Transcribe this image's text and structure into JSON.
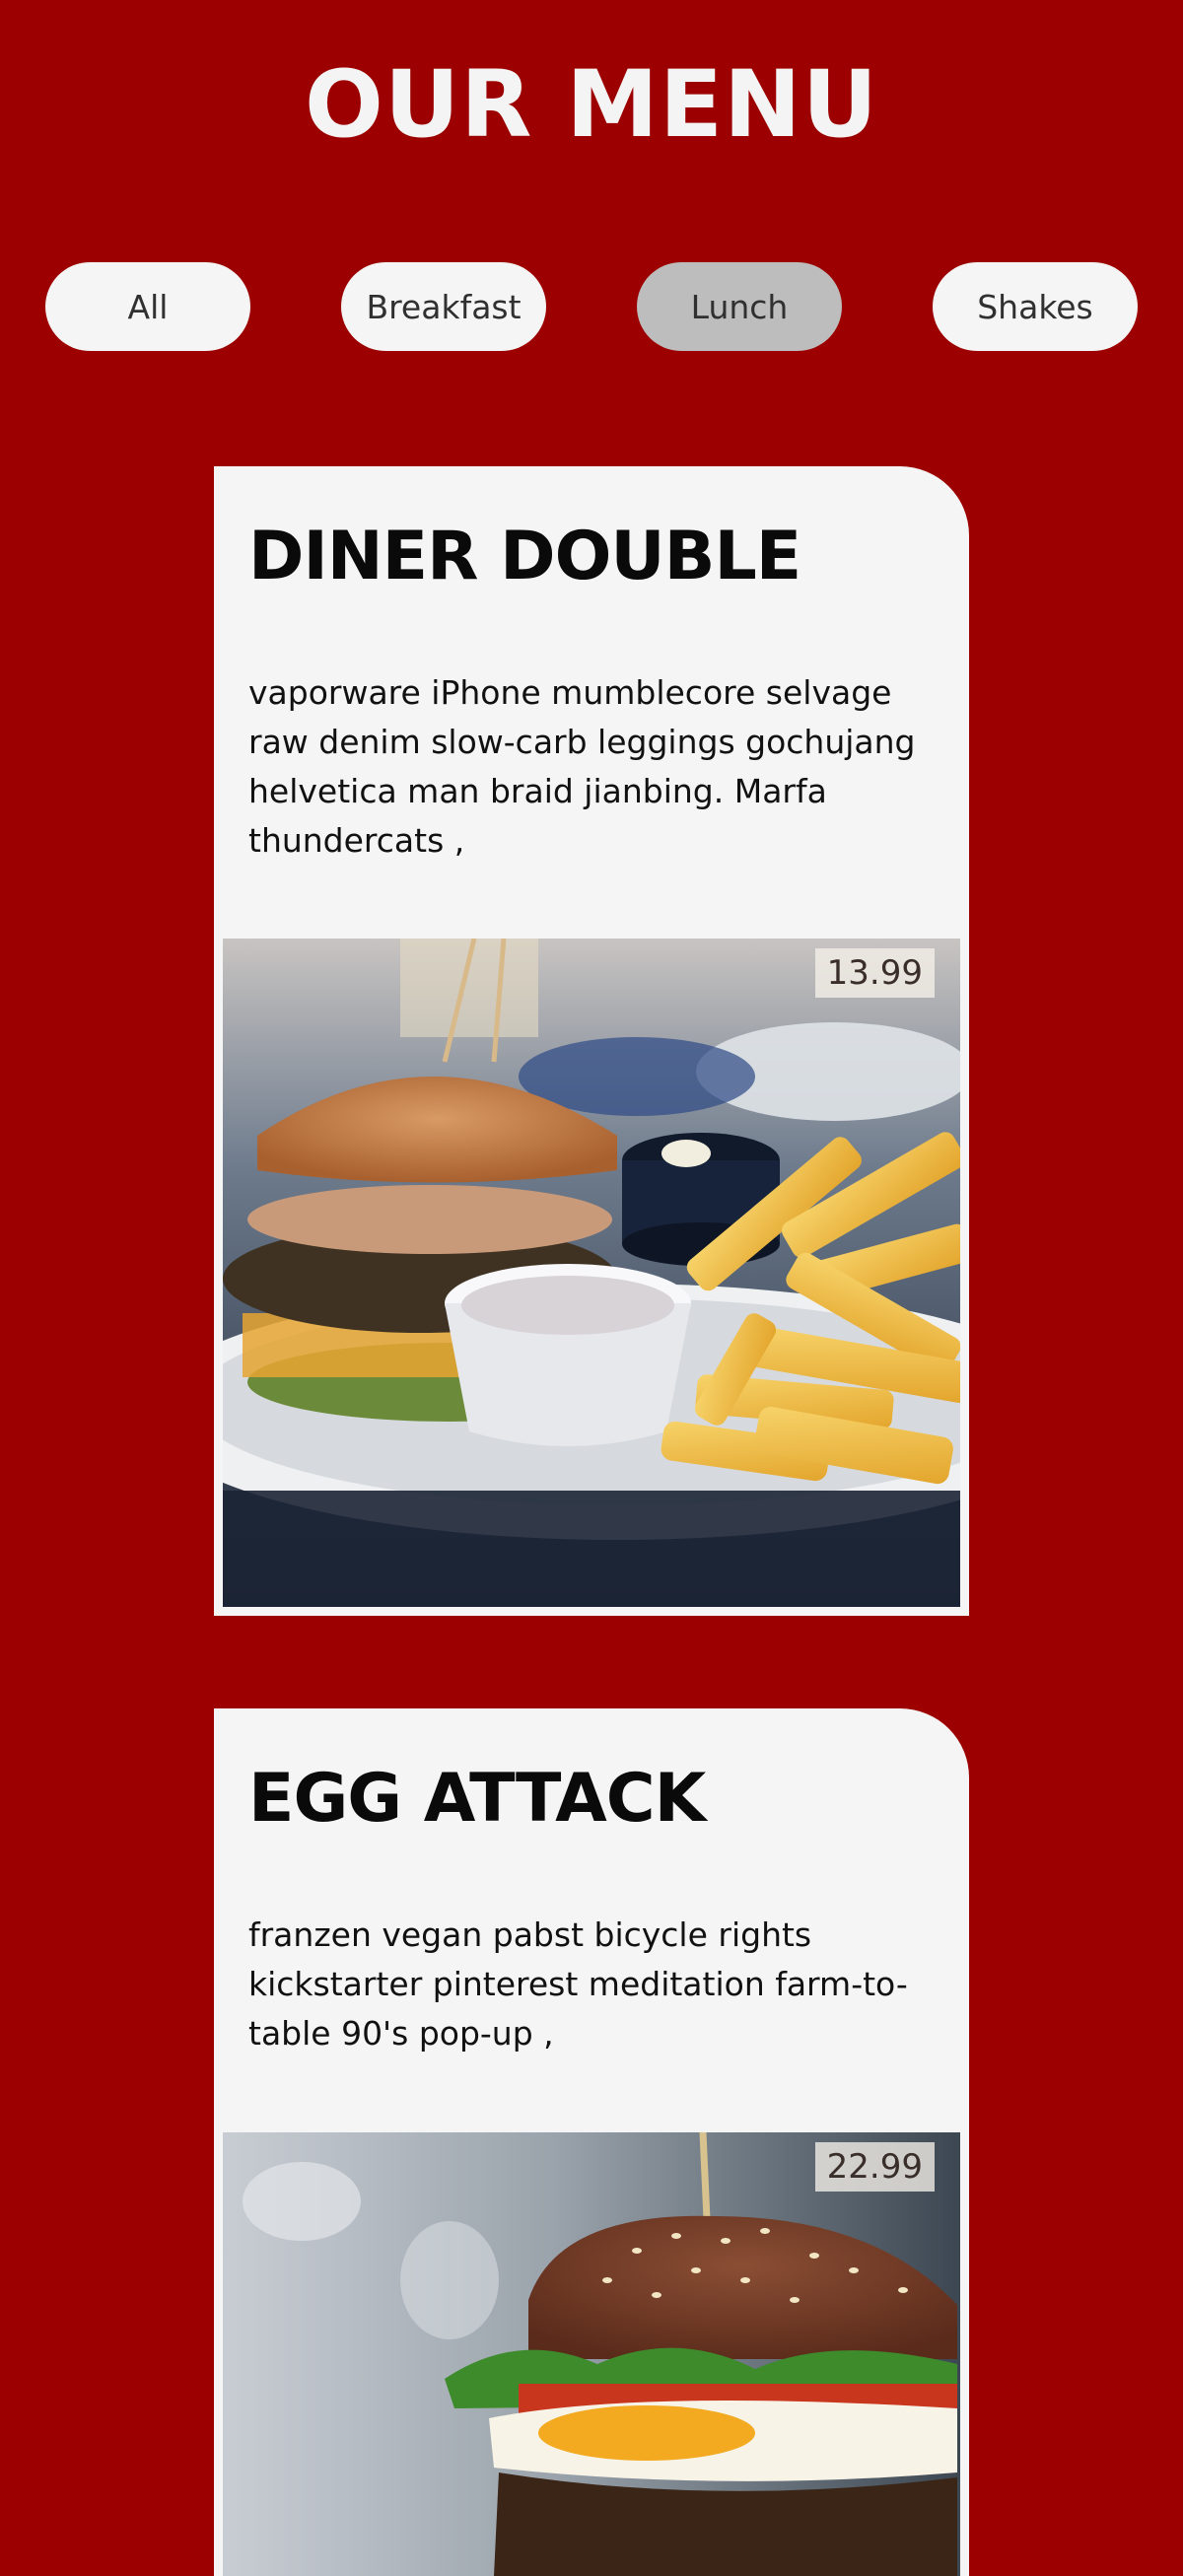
{
  "header": {
    "title": "OUR MENU"
  },
  "filters": [
    {
      "label": "All",
      "active": false
    },
    {
      "label": "Breakfast",
      "active": false
    },
    {
      "label": "Lunch",
      "active": true
    },
    {
      "label": "Shakes",
      "active": false
    }
  ],
  "menu_items": [
    {
      "title": "DINER DOUBLE",
      "description": "vaporware iPhone mumblecore selvage raw denim slow-carb leggings gochujang helvetica man braid jianbing. Marfa thundercats ,",
      "price": "13.99",
      "photo": "burger-with-fries-photo"
    },
    {
      "title": "EGG ATTACK",
      "description": "franzen vegan pabst bicycle rights kickstarter pinterest meditation farm-to-table 90's pop-up ,",
      "price": "22.99",
      "photo": "egg-burger-photo"
    }
  ],
  "colors": {
    "background": "#9c0000",
    "card": "#f5f5f5",
    "active_filter": "#bdbdbd",
    "filter": "#f5f5f5"
  }
}
